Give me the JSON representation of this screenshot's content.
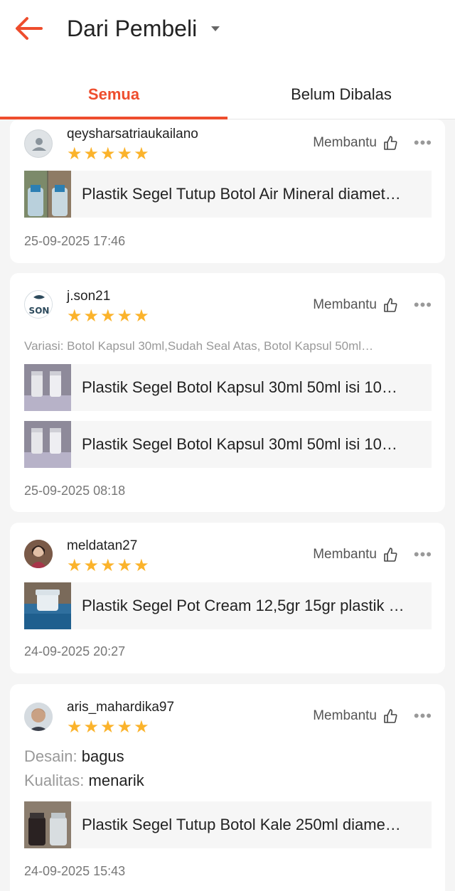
{
  "header": {
    "title": "Dari Pembeli"
  },
  "tabs": [
    {
      "label": "Semua",
      "active": true
    },
    {
      "label": "Belum Dibalas",
      "active": false
    }
  ],
  "colors": {
    "accent": "#ee4d2d",
    "star": "#fbb32b"
  },
  "reviews": [
    {
      "username": "qeysharsatriaukailano",
      "rating": 5,
      "helpful_label": "Membantu",
      "products": [
        "Plastik Segel Tutup Botol Air Mineral diamet…"
      ],
      "date": "25-09-2025 17:46"
    },
    {
      "username": "j.son21",
      "rating": 5,
      "helpful_label": "Membantu",
      "variation": "Variasi: Botol Kapsul 30ml,Sudah Seal Atas, Botol Kapsul 50ml…",
      "products": [
        "Plastik Segel Botol Kapsul 30ml 50ml isi 10…",
        "Plastik Segel Botol Kapsul 30ml 50ml isi 10…"
      ],
      "date": "25-09-2025 08:18"
    },
    {
      "username": "meldatan27",
      "rating": 5,
      "helpful_label": "Membantu",
      "products": [
        "Plastik Segel Pot Cream 12,5gr 15gr plastik …"
      ],
      "date": "24-09-2025 20:27"
    },
    {
      "username": "aris_mahardika97",
      "rating": 5,
      "helpful_label": "Membantu",
      "attributes": [
        {
          "key": "Desain:",
          "value": "bagus"
        },
        {
          "key": "Kualitas:",
          "value": "menarik"
        }
      ],
      "products": [
        "Plastik Segel Tutup Botol Kale 250ml diame…"
      ],
      "date": "24-09-2025 15:43"
    }
  ]
}
